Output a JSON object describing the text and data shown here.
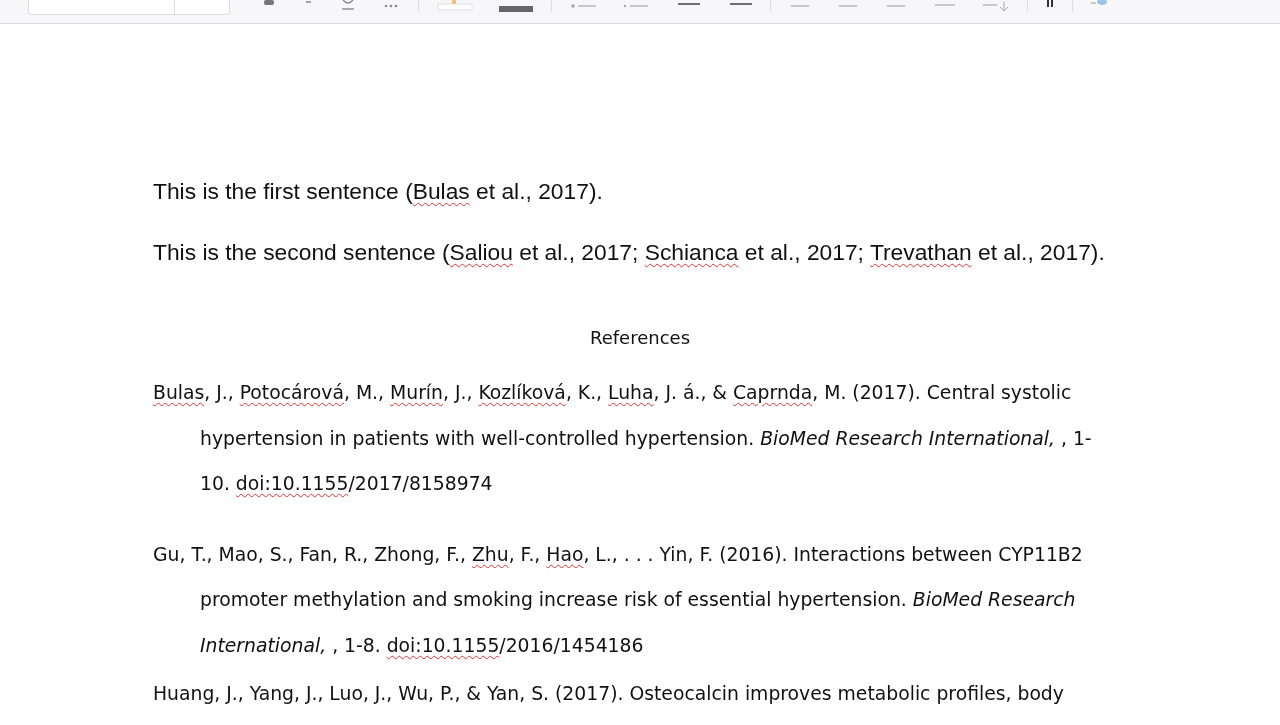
{
  "body": [
    {
      "kind": "sentence",
      "segments": [
        {
          "text": "This is the first sentence (",
          "misspelled": false
        },
        {
          "text": "Bulas",
          "misspelled": true
        },
        {
          "text": " et al., 2017).",
          "misspelled": false
        }
      ]
    },
    {
      "kind": "sentence",
      "segments": [
        {
          "text": "This is the second sentence (",
          "misspelled": false
        },
        {
          "text": "Saliou",
          "misspelled": true
        },
        {
          "text": " et al., 2017; ",
          "misspelled": false
        },
        {
          "text": "Schianca",
          "misspelled": true
        },
        {
          "text": " et al., 2017; ",
          "misspelled": false
        },
        {
          "text": "Trevathan",
          "misspelled": true
        },
        {
          "text": " et al., 2017).",
          "misspelled": false
        }
      ]
    },
    {
      "kind": "heading",
      "segments": [
        {
          "text": "References",
          "misspelled": false
        }
      ]
    },
    {
      "kind": "reference",
      "segments": [
        {
          "text": "Bulas",
          "misspelled": true
        },
        {
          "text": ", J., ",
          "misspelled": false
        },
        {
          "text": "Potocárová",
          "misspelled": true
        },
        {
          "text": ", M., ",
          "misspelled": false
        },
        {
          "text": "Murín",
          "misspelled": true
        },
        {
          "text": ", J., ",
          "misspelled": false
        },
        {
          "text": "Kozlíková",
          "misspelled": true
        },
        {
          "text": ", K., ",
          "misspelled": false
        },
        {
          "text": "Luha",
          "misspelled": true
        },
        {
          "text": ", J. á., & ",
          "misspelled": false
        },
        {
          "text": "Caprnda",
          "misspelled": true
        },
        {
          "text": ", M. (2017). Central systolic hypertension in patients with well-controlled hypertension. *BioMed Research International,* , 1-10. ",
          "misspelled": false
        },
        {
          "text": "doi:10.1155",
          "misspelled": true
        },
        {
          "text": "/2017/8158974",
          "misspelled": false
        }
      ]
    },
    {
      "kind": "reference",
      "segments": [
        {
          "text": "Gu, T., Mao, S., Fan, R., Zhong, F., ",
          "misspelled": false
        },
        {
          "text": "Zhu",
          "misspelled": true
        },
        {
          "text": ", F., ",
          "misspelled": false
        },
        {
          "text": "Hao",
          "misspelled": true
        },
        {
          "text": ", L., . . . Yin, F. (2016). Interactions between CYP11B2 promoter methylation and smoking increase risk of essential hypertension. *BioMed Research International,* , 1-8. ",
          "misspelled": false
        },
        {
          "text": "doi:10.1155",
          "misspelled": true
        },
        {
          "text": "/2016/1454186",
          "misspelled": false
        }
      ]
    },
    {
      "kind": "reference",
      "segments": [
        {
          "text": "Huang, J., Yang, J., Luo, J., Wu, P., & Yan, S. (2017). Osteocalcin improves metabolic profiles, body",
          "misspelled": false
        }
      ]
    }
  ]
}
